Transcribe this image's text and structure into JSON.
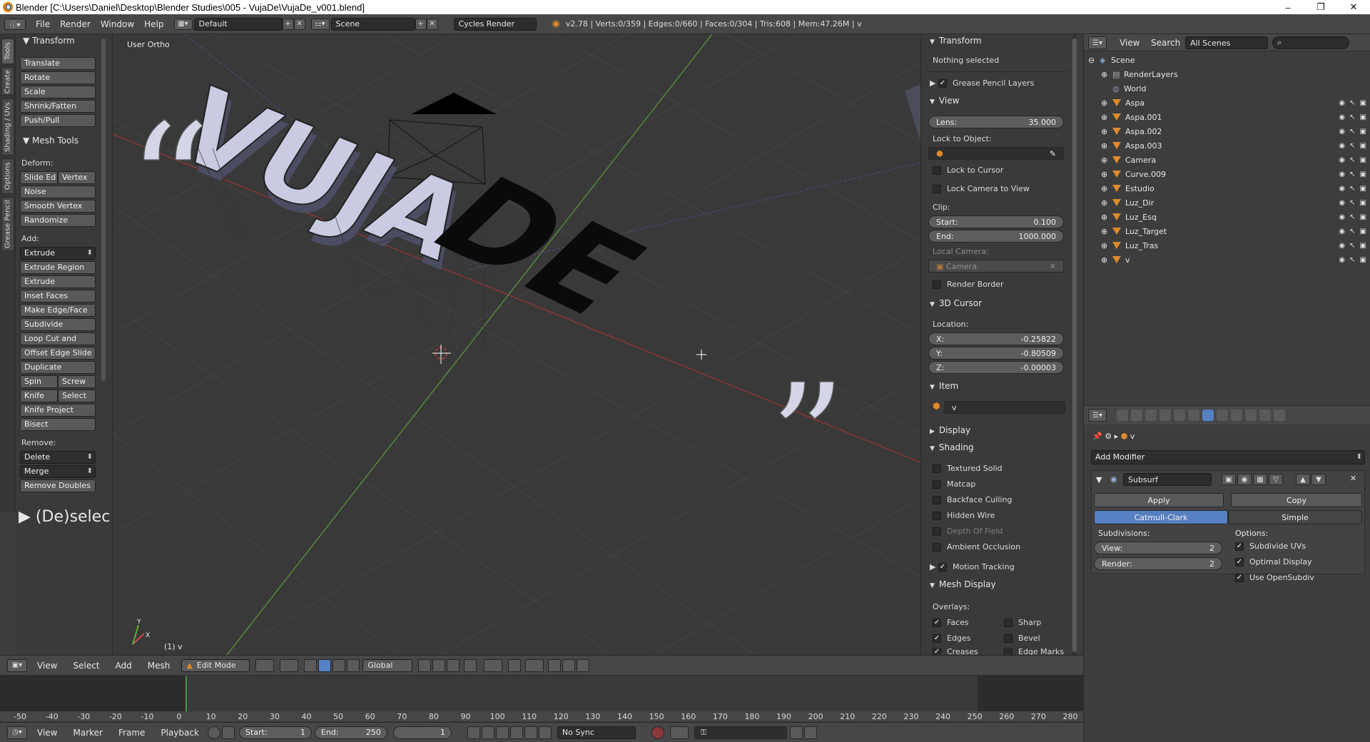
{
  "window": {
    "title": "Blender [C:\\Users\\Daniel\\Desktop\\Blender Studies\\005 - VujaDe\\VujaDe_v001.blend]",
    "minimize": "–",
    "restore": "❐",
    "close": "✕"
  },
  "info_header": {
    "menus": [
      "File",
      "Render",
      "Window",
      "Help"
    ],
    "layout": "Default",
    "scene": "Scene",
    "engine": "Cycles Render",
    "stats": "v2.78 | Verts:0/359 | Edges:0/660 | Faces:0/304 | Tris:608 | Mem:47.26M | v"
  },
  "vertical_tabs": [
    "Tools",
    "Create",
    "Shading / UVs",
    "Options",
    "Grease Pencil"
  ],
  "tool_shelf": {
    "transform_header": "Transform",
    "transform_buttons": [
      "Translate",
      "Rotate",
      "Scale",
      "Shrink/Fatten",
      "Push/Pull"
    ],
    "mesh_tools_header": "Mesh Tools",
    "deform_label": "Deform:",
    "deform_pair": [
      "Slide Ed",
      "Vertex"
    ],
    "deform_buttons": [
      "Noise",
      "Smooth Vertex",
      "Randomize"
    ],
    "add_label": "Add:",
    "extrude_dropdown": "Extrude",
    "add_buttons": [
      "Extrude Region",
      "Extrude Individual",
      "Inset Faces",
      "Make Edge/Face",
      "Subdivide",
      "Loop Cut and Slide",
      "Offset Edge Slide",
      "Duplicate"
    ],
    "spin_pair": [
      "Spin",
      "Screw"
    ],
    "knife_pair": [
      "Knife",
      "Select"
    ],
    "knife_buttons": [
      "Knife Project",
      "Bisect"
    ],
    "remove_label": "Remove:",
    "delete_dropdown": "Delete",
    "merge_dropdown": "Merge",
    "remove_doubles": "Remove Doubles",
    "deselect_panel": "(De)selec"
  },
  "viewport": {
    "view_label": "User Ortho",
    "object_label": "(1) v",
    "text_3d": "VUJA",
    "text_3d_shadow": "DE",
    "quote_open": "“",
    "quote_close": "”",
    "axis_y": "Y",
    "axis_x": "X"
  },
  "n_panel": {
    "transform": "Transform",
    "nothing_selected": "Nothing selected",
    "grease_pencil": "Grease Pencil Layers",
    "view": "View",
    "lens_label": "Lens:",
    "lens_value": "35.000",
    "lock_to_object": "Lock to Object:",
    "lock_to_cursor": "Lock to Cursor",
    "lock_camera": "Lock Camera to View",
    "clip": "Clip:",
    "clip_start_label": "Start:",
    "clip_start": "0.100",
    "clip_end_label": "End:",
    "clip_end": "1000.000",
    "local_camera": "Local Camera:",
    "camera_field": "Camera",
    "render_border": "Render Border",
    "cursor_header": "3D Cursor",
    "location": "Location:",
    "x_label": "X:",
    "x_value": "-0.25822",
    "y_label": "Y:",
    "y_value": "-0.80509",
    "z_label": "Z:",
    "z_value": "-0.00003",
    "item": "Item",
    "item_name": "v",
    "display": "Display",
    "shading": "Shading",
    "shading_options": [
      "Textured Solid",
      "Matcap",
      "Backface Culling",
      "Hidden Wire",
      "Depth Of Field",
      "Ambient Occlusion"
    ],
    "motion_tracking": "Motion Tracking",
    "mesh_display": "Mesh Display",
    "overlays": "Overlays:",
    "overlay_left": [
      "Faces",
      "Edges",
      "Creases"
    ],
    "overlay_right": [
      "Sharp",
      "Bevel",
      "Edge Marks"
    ]
  },
  "outliner": {
    "view": "View",
    "search": "Search",
    "scenes": "All Scenes",
    "scene": "Scene",
    "render_layers": "RenderLayers",
    "world": "World",
    "objects": [
      "Aspa",
      "Aspa.001",
      "Aspa.002",
      "Aspa.003",
      "Camera",
      "Curve.009",
      "Estudio",
      "Luz_Dir",
      "Luz_Esq",
      "Luz_Target",
      "Luz_Tras",
      "v"
    ]
  },
  "properties": {
    "object_name": "v",
    "add_modifier": "Add Modifier",
    "modifier_name": "Subsurf",
    "apply": "Apply",
    "copy": "Copy",
    "catmull": "Catmull-Clark",
    "simple": "Simple",
    "subdivisions": "Subdivisions:",
    "view_label": "View:",
    "view_value": "2",
    "render_label": "Render:",
    "render_value": "2",
    "options": "Options:",
    "option_items": [
      "Subdivide UVs",
      "Optimal Display",
      "Use OpenSubdiv"
    ]
  },
  "viewport_header": {
    "menus": [
      "View",
      "Select",
      "Add",
      "Mesh"
    ],
    "mode": "Edit Mode",
    "orientation": "Global"
  },
  "timeline": {
    "ticks": [
      "-50",
      "-40",
      "-30",
      "-20",
      "-10",
      "0",
      "10",
      "20",
      "30",
      "40",
      "50",
      "60",
      "70",
      "80",
      "90",
      "100",
      "110",
      "120",
      "130",
      "140",
      "150",
      "160",
      "170",
      "180",
      "190",
      "200",
      "210",
      "220",
      "230",
      "240",
      "250",
      "260",
      "270",
      "280"
    ],
    "current_frame": 1
  },
  "timeline_header": {
    "menus": [
      "View",
      "Marker",
      "Frame",
      "Playback"
    ],
    "start_label": "Start:",
    "start": "1",
    "end_label": "End:",
    "end": "250",
    "frame": "1",
    "sync": "No Sync"
  },
  "colors": {
    "accent": "#5680c2",
    "object_orange": "#e08a2a",
    "axis_red": "#9e3434",
    "axis_green": "#5b9b36"
  }
}
